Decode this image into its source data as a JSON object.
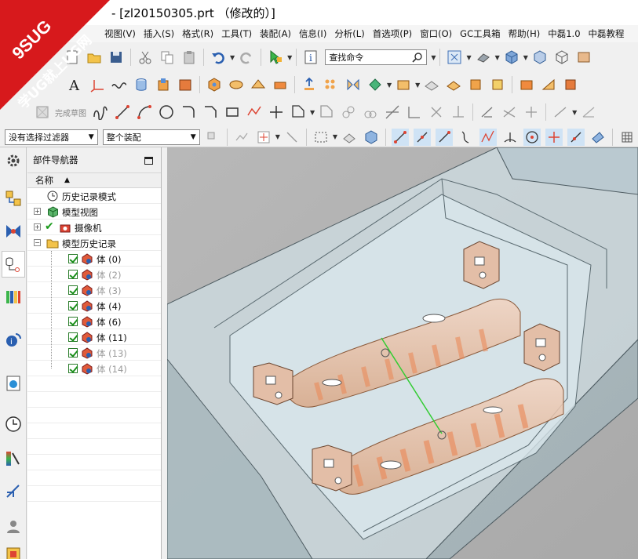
{
  "window": {
    "title": "- [zl20150305.prt （修改的）]"
  },
  "watermark": {
    "line1": "9SUG",
    "line2": "学UG就上UG网",
    "color": "#d7191c"
  },
  "menu": [
    {
      "label": "视图(V)",
      "name": "menu-view"
    },
    {
      "label": "插入(S)",
      "name": "menu-insert"
    },
    {
      "label": "格式(R)",
      "name": "menu-format"
    },
    {
      "label": "工具(T)",
      "name": "menu-tools"
    },
    {
      "label": "装配(A)",
      "name": "menu-assembly"
    },
    {
      "label": "信息(I)",
      "name": "menu-info"
    },
    {
      "label": "分析(L)",
      "name": "menu-analysis"
    },
    {
      "label": "首选项(P)",
      "name": "menu-preferences"
    },
    {
      "label": "窗口(O)",
      "name": "menu-window"
    },
    {
      "label": "GC工具箱",
      "name": "menu-gc-toolkit"
    },
    {
      "label": "帮助(H)",
      "name": "menu-help"
    },
    {
      "label": "中磊1.0",
      "name": "menu-zhonglei"
    },
    {
      "label": "中磊教程",
      "name": "menu-zhonglei-tutorial"
    }
  ],
  "toolbar": {
    "command_search_placeholder": "查找命令",
    "finish_sketch_label": "完成草图",
    "selection_filter": "没有选择过滤器",
    "assembly_scope": "整个装配"
  },
  "navigator": {
    "title": "部件导航器",
    "column_name": "名称",
    "items": [
      {
        "label": "历史记录模式",
        "level": 1,
        "icon": "clock-icon",
        "expand": "",
        "check": false,
        "dim": false
      },
      {
        "label": "模型视图",
        "level": 1,
        "icon": "model-views-icon",
        "expand": "+",
        "check": false,
        "dim": false
      },
      {
        "label": "摄像机",
        "level": 1,
        "icon": "camera-icon",
        "expand": "+",
        "check": true,
        "dim": false
      },
      {
        "label": "模型历史记录",
        "level": 1,
        "icon": "folder-icon",
        "expand": "-",
        "check": false,
        "dim": false
      },
      {
        "label": "体 (0)",
        "level": 2,
        "icon": "body-icon",
        "expand": "",
        "check": true,
        "dim": false
      },
      {
        "label": "体 (2)",
        "level": 2,
        "icon": "body-icon",
        "expand": "",
        "check": true,
        "dim": true
      },
      {
        "label": "体 (3)",
        "level": 2,
        "icon": "body-icon",
        "expand": "",
        "check": true,
        "dim": true
      },
      {
        "label": "体 (4)",
        "level": 2,
        "icon": "body-icon",
        "expand": "",
        "check": true,
        "dim": false
      },
      {
        "label": "体 (6)",
        "level": 2,
        "icon": "body-icon",
        "expand": "",
        "check": true,
        "dim": false
      },
      {
        "label": "体 (11)",
        "level": 2,
        "icon": "body-icon",
        "expand": "",
        "check": true,
        "dim": false
      },
      {
        "label": "体 (13)",
        "level": 2,
        "icon": "body-icon",
        "expand": "",
        "check": true,
        "dim": true
      },
      {
        "label": "体 (14)",
        "level": 2,
        "icon": "body-icon",
        "expand": "",
        "check": true,
        "dim": true
      }
    ]
  },
  "colors": {
    "viewport_background": "#b4b4b4",
    "mold_block": "#c7d5dc",
    "part": "#e9c7b3",
    "measure_line": "#33cc33"
  }
}
